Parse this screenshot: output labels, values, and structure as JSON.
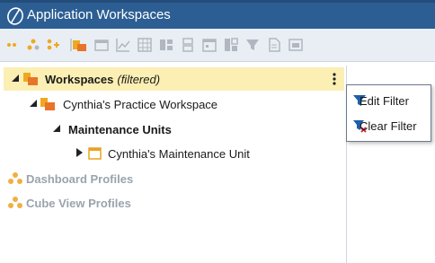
{
  "window": {
    "title": "Application Workspaces",
    "accent": "#2c5e93"
  },
  "toolbar": {
    "icons": [
      "dots-icon",
      "create-group-icon",
      "create-profile-icon",
      "separator",
      "workspace-icon",
      "dashboard-icon",
      "chart-icon",
      "grid-icon",
      "table-icon",
      "split-icon",
      "calendar-icon",
      "columns-icon",
      "filter-icon",
      "document-icon",
      "image-icon"
    ]
  },
  "tree": {
    "workspaces": {
      "label": "Workspaces",
      "note": "(filtered)"
    },
    "practice_workspace": {
      "label": "Cynthia's Practice Workspace"
    },
    "maintenance_units": {
      "label": "Maintenance Units"
    },
    "maintenance_unit": {
      "label": "Cynthia's Maintenance Unit"
    },
    "dashboard_profiles": {
      "label": "Dashboard Profiles"
    },
    "cube_view_profiles": {
      "label": "Cube View Profiles"
    }
  },
  "context_menu": {
    "edit_filter": {
      "label": "Edit Filter"
    },
    "clear_filter": {
      "label": "Clear Filter"
    }
  }
}
